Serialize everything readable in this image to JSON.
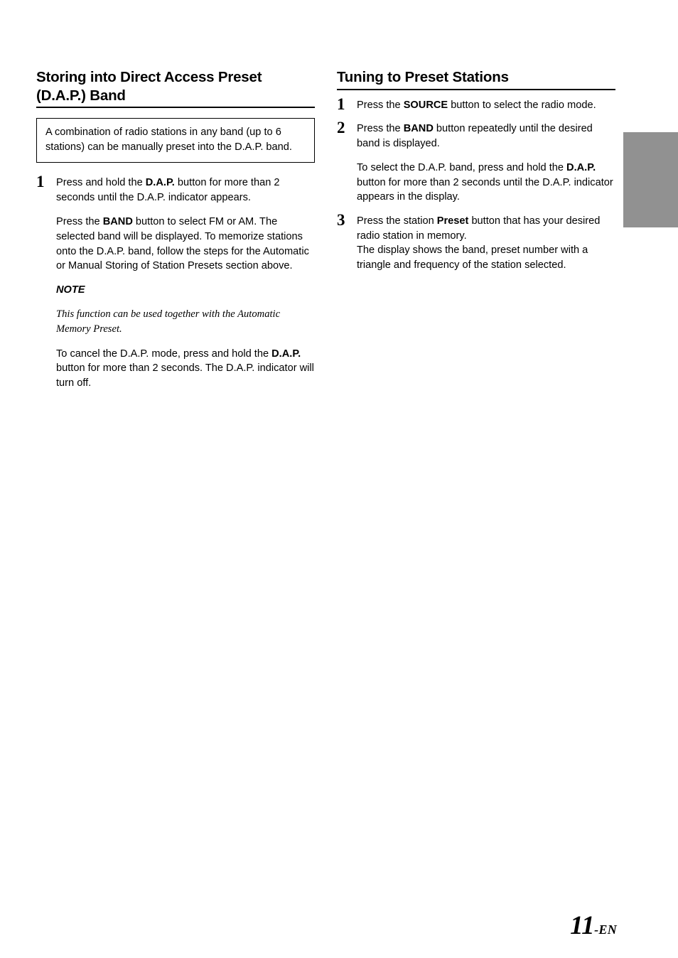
{
  "page": {
    "number": "11",
    "suffix": "-EN",
    "background_color": "#ffffff",
    "text_color": "#000000"
  },
  "thumb_tab": {
    "name": "thumb-index-tab",
    "color": "#919191",
    "label": ""
  },
  "left_column": {
    "heading": "Storing into Direct Access Preset (D.A.P.) Band",
    "info_box": {
      "text": "A combination of radio stations in any band (up to 6 stations) can be manually preset into the D.A.P. band."
    },
    "steps": [
      {
        "number": "1",
        "paragraphs": [
          {
            "segments": [
              {
                "text": "Press and hold the ",
                "bold": false
              },
              {
                "text": "D.A.P.",
                "bold": true
              },
              {
                "text": " button for more than 2 seconds until the D.A.P. indicator appears.",
                "bold": false
              }
            ]
          },
          {
            "segments": [
              {
                "text": "Press the ",
                "bold": false
              },
              {
                "text": "BAND",
                "bold": true
              },
              {
                "text": " button to select FM or AM. The selected band will be displayed. To memorize stations onto the D.A.P. band, follow the steps for the Automatic or Manual Storing of Station Presets section above.",
                "bold": false
              }
            ]
          }
        ]
      }
    ],
    "note": {
      "label": "NOTE",
      "text": "This function can be used together with the Automatic Memory Preset."
    },
    "closing_paragraph": {
      "segments": [
        {
          "text": "To cancel the D.A.P. mode, press and hold the ",
          "bold": false
        },
        {
          "text": "D.A.P.",
          "bold": true
        },
        {
          "text": " button for more than 2 seconds. The D.A.P. indicator will turn off.",
          "bold": false
        }
      ]
    }
  },
  "right_column": {
    "heading": "Tuning to Preset Stations",
    "steps": [
      {
        "number": "1",
        "paragraphs": [
          {
            "segments": [
              {
                "text": "Press the ",
                "bold": false
              },
              {
                "text": "SOURCE",
                "bold": true
              },
              {
                "text": " button to select the radio mode.",
                "bold": false
              }
            ]
          }
        ]
      },
      {
        "number": "2",
        "paragraphs": [
          {
            "segments": [
              {
                "text": "Press the ",
                "bold": false
              },
              {
                "text": "BAND",
                "bold": true
              },
              {
                "text": " button repeatedly until the desired band is displayed.",
                "bold": false
              }
            ]
          },
          {
            "segments": [
              {
                "text": "To select the D.A.P. band, press and hold the ",
                "bold": false
              },
              {
                "text": "D.A.P.",
                "bold": true
              },
              {
                "text": " button for more than 2 seconds until the D.A.P. indicator appears in the display.",
                "bold": false
              }
            ]
          }
        ]
      },
      {
        "number": "3",
        "paragraphs": [
          {
            "segments": [
              {
                "text": "Press the station ",
                "bold": false
              },
              {
                "text": "Preset",
                "bold": true
              },
              {
                "text": " button that has your desired radio station in memory.",
                "bold": false
              }
            ]
          },
          {
            "run_on": true,
            "segments": [
              {
                "text": "The display shows the band, preset number with a triangle and frequency of the station selected.",
                "bold": false
              }
            ]
          }
        ]
      }
    ]
  }
}
